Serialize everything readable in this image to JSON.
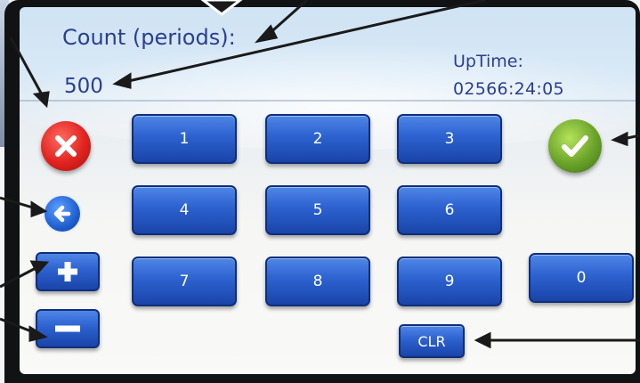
{
  "screen": {
    "count_label": "Count (periods):",
    "count_value": "500",
    "uptime_label": "UpTime:",
    "uptime_value": "02566:24:05"
  },
  "keypad": {
    "keys": [
      "1",
      "2",
      "3",
      "4",
      "5",
      "6",
      "7",
      "8",
      "9",
      "0"
    ],
    "clear_label": "CLR"
  },
  "controls": {
    "cancel_icon": "x-icon",
    "confirm_icon": "checkmark-icon",
    "back_icon": "arrow-left-icon",
    "plus_icon": "plus-icon",
    "minus_icon": "minus-icon"
  },
  "colors": {
    "text": "#2a3f8e",
    "key_blue": "#2c61cf",
    "cancel_red": "#e0231f",
    "confirm_green": "#6aa32a",
    "callout_arrow": "#1a1a1a"
  }
}
